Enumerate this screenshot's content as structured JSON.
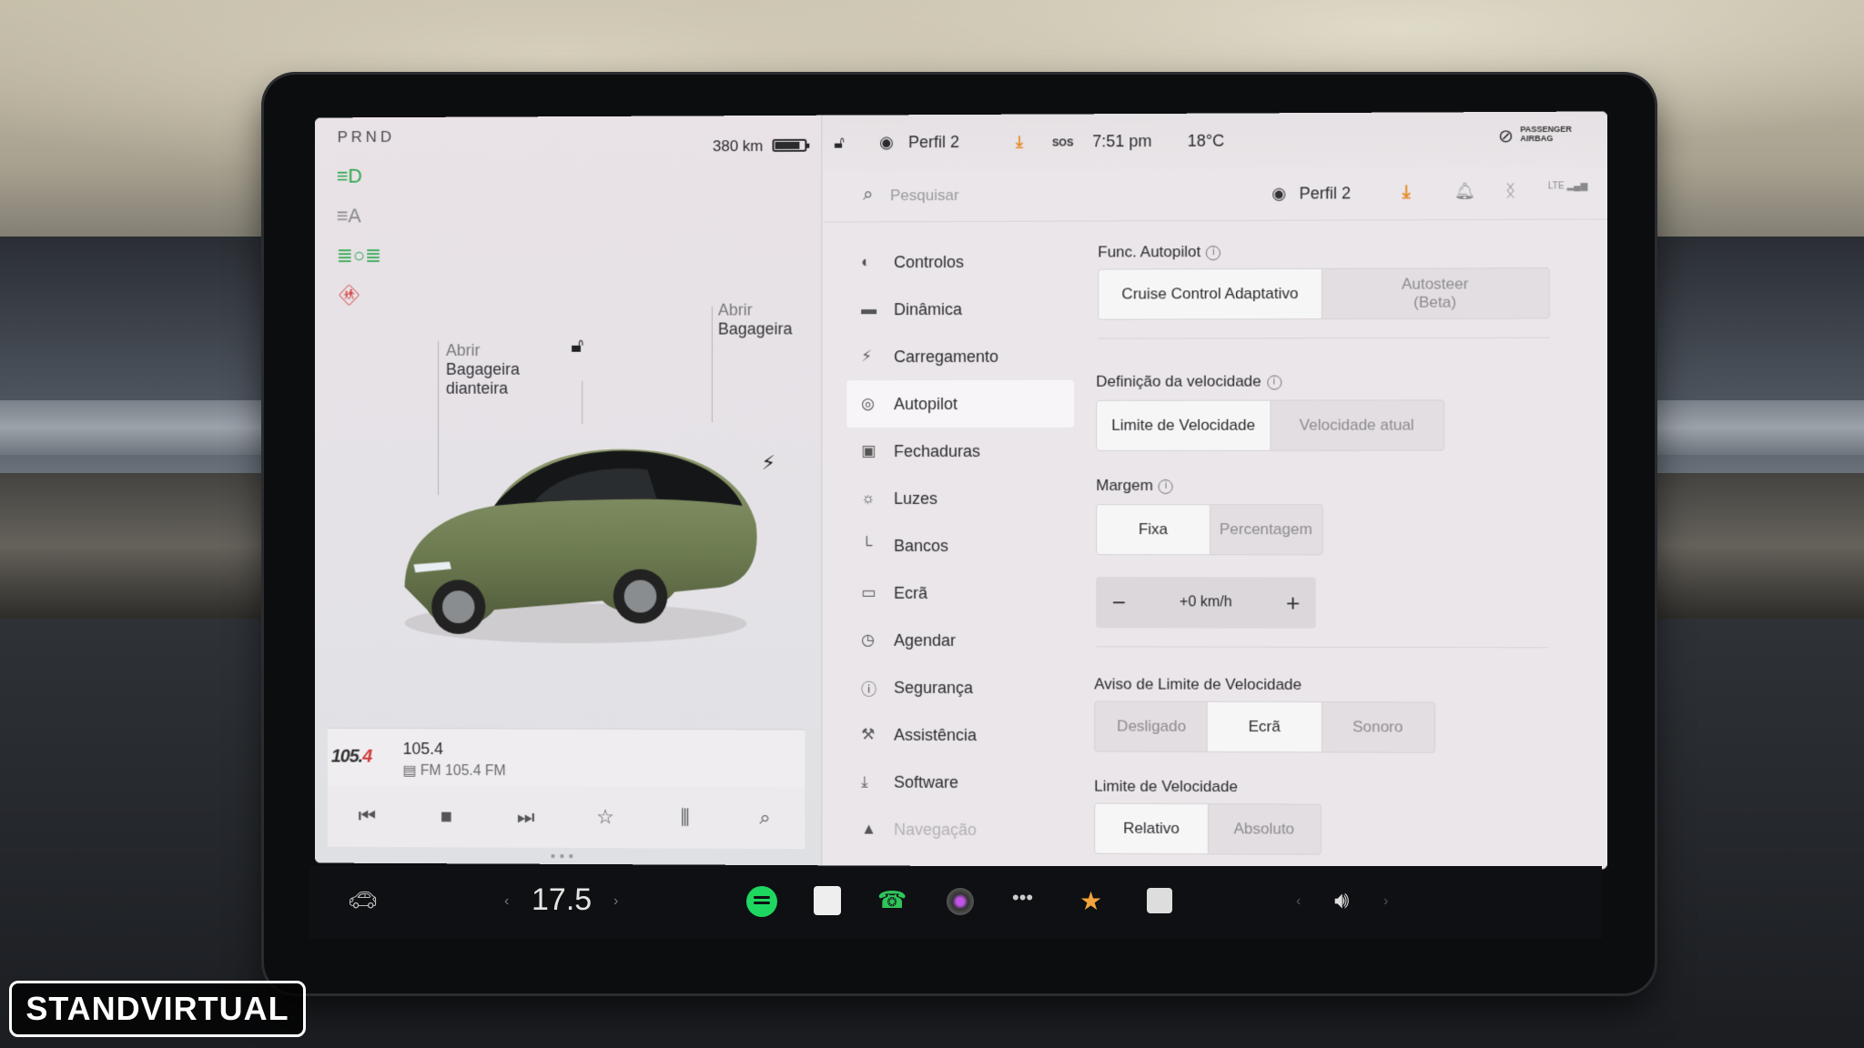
{
  "left": {
    "gear": "PRND",
    "range": "380 km",
    "battery_level": 0.85,
    "frunk_label": "Abrir",
    "frunk_name": "Bagageira dianteira",
    "trunk_label": "Abrir",
    "trunk_name": "Bagageira",
    "media": {
      "logo_main": "105.",
      "logo_accent": "4",
      "station": "105.4",
      "sub": "FM 105.4 FM"
    }
  },
  "status": {
    "profile": "Perfil 2",
    "sos": "SOS",
    "time": "7:51 pm",
    "temp": "18°C",
    "airbag_line1": "PASSENGER",
    "airbag_line2": "AIRBAG"
  },
  "header": {
    "search_placeholder": "Pesquisar",
    "profile": "Perfil 2",
    "network": "LTE"
  },
  "nav": {
    "items": [
      {
        "label": "Controlos",
        "icon": "toggle-icon"
      },
      {
        "label": "Dinâmica",
        "icon": "car-icon"
      },
      {
        "label": "Carregamento",
        "icon": "bolt-icon"
      },
      {
        "label": "Autopilot",
        "icon": "steering-wheel-icon"
      },
      {
        "label": "Fechaduras",
        "icon": "lock-icon"
      },
      {
        "label": "Luzes",
        "icon": "sun-icon"
      },
      {
        "label": "Bancos",
        "icon": "seat-icon"
      },
      {
        "label": "Ecrã",
        "icon": "display-icon"
      },
      {
        "label": "Agendar",
        "icon": "clock-icon"
      },
      {
        "label": "Segurança",
        "icon": "info-icon"
      },
      {
        "label": "Assistência",
        "icon": "wrench-icon"
      },
      {
        "label": "Software",
        "icon": "download-icon"
      },
      {
        "label": "Navegação",
        "icon": "navigation-icon"
      }
    ]
  },
  "settings": {
    "autopilot_title": "Func. Autopilot",
    "autopilot_opt1": "Cruise Control Adaptativo",
    "autopilot_opt2": "Autosteer\n(Beta)",
    "speed_title": "Definição da velocidade",
    "speed_opt1": "Limite de Velocidade",
    "speed_opt2": "Velocidade atual",
    "margin_title": "Margem",
    "margin_opt1": "Fixa",
    "margin_opt2": "Percentagem",
    "margin_value": "+0 km/h",
    "warn_title": "Aviso de Limite de Velocidade",
    "warn_opt1": "Desligado",
    "warn_opt2": "Ecrã",
    "warn_opt3": "Sonoro",
    "limit_title": "Limite de Velocidade",
    "limit_opt1": "Relativo",
    "limit_opt2": "Absoluto"
  },
  "taskbar": {
    "cabin_temp": "17.5"
  },
  "watermark": "STANDVIRTUAL"
}
